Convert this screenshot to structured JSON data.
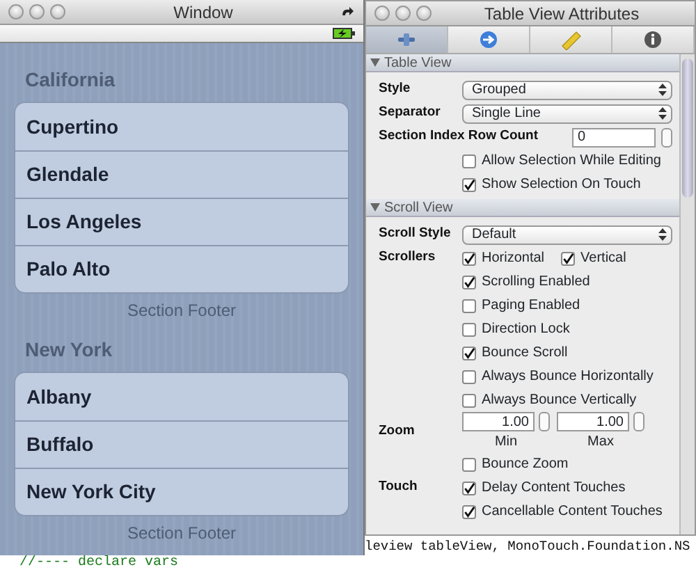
{
  "code_lines": [
    "leview tableView, MonoTouch.Foundation.NS",
    "//---- declare vars"
  ],
  "simulator": {
    "title": "Window",
    "sections": [
      {
        "header": "California",
        "rows": [
          "Cupertino",
          "Glendale",
          "Los Angeles",
          "Palo Alto"
        ],
        "footer": "Section Footer"
      },
      {
        "header": "New York",
        "rows": [
          "Albany",
          "Buffalo",
          "New York City"
        ],
        "footer": "Section Footer"
      }
    ]
  },
  "inspector": {
    "title": "Table View Attributes",
    "tabs": [
      {
        "kind": "attributes",
        "selected": true
      },
      {
        "kind": "connections",
        "selected": false
      },
      {
        "kind": "size",
        "selected": false
      },
      {
        "kind": "identity",
        "selected": false
      }
    ],
    "groups": [
      {
        "title": "Table View",
        "expanded": true,
        "fields": [
          {
            "kind": "select",
            "label": "Style",
            "value": "Grouped"
          },
          {
            "kind": "select",
            "label": "Separator",
            "value": "Single Line"
          },
          {
            "kind": "stepper",
            "label": "Section Index Row Count",
            "value": "0"
          },
          {
            "kind": "checks",
            "items": [
              {
                "text": "Allow Selection While Editing",
                "checked": false
              }
            ]
          },
          {
            "kind": "checks",
            "items": [
              {
                "text": "Show Selection On Touch",
                "checked": true
              }
            ]
          }
        ]
      },
      {
        "title": "Scroll View",
        "expanded": true,
        "fields": [
          {
            "kind": "select",
            "label": "Scroll Style",
            "value": "Default"
          },
          {
            "kind": "checks",
            "label": "Scrollers",
            "items": [
              {
                "text": "Horizontal",
                "checked": true
              },
              {
                "text": "Vertical",
                "checked": true
              }
            ]
          },
          {
            "kind": "checks",
            "items": [
              {
                "text": "Scrolling Enabled",
                "checked": true
              }
            ]
          },
          {
            "kind": "checks",
            "items": [
              {
                "text": "Paging Enabled",
                "checked": false
              }
            ]
          },
          {
            "kind": "checks",
            "items": [
              {
                "text": "Direction Lock",
                "checked": false
              }
            ]
          },
          {
            "kind": "checks",
            "items": [
              {
                "text": "Bounce Scroll",
                "checked": true
              }
            ]
          },
          {
            "kind": "checks",
            "items": [
              {
                "text": "Always Bounce Horizontally",
                "checked": false
              }
            ]
          },
          {
            "kind": "checks",
            "items": [
              {
                "text": "Always Bounce Vertically",
                "checked": false
              }
            ]
          },
          {
            "kind": "range",
            "label": "Zoom",
            "min": "1.00",
            "max": "1.00",
            "min_caption": "Min",
            "max_caption": "Max"
          },
          {
            "kind": "checks",
            "items": [
              {
                "text": "Bounce Zoom",
                "checked": false
              }
            ]
          },
          {
            "kind": "checks",
            "label": "Touch",
            "items": [
              {
                "text": "Delay Content Touches",
                "checked": true
              }
            ]
          },
          {
            "kind": "checks",
            "items": [
              {
                "text": "Cancellable Content Touches",
                "checked": true
              }
            ]
          }
        ]
      }
    ]
  }
}
